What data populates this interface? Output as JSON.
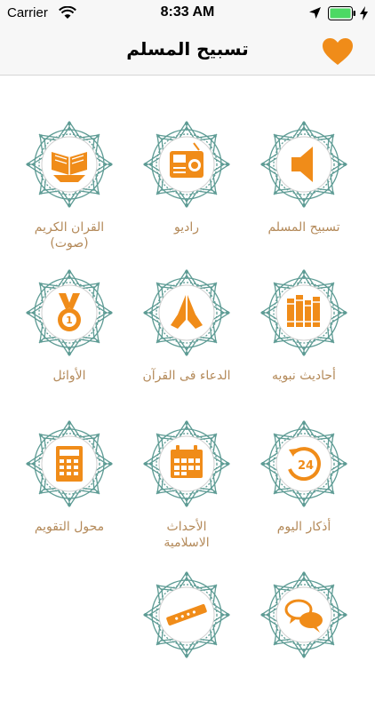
{
  "status_bar": {
    "carrier": "Carrier",
    "time": "8:33 AM"
  },
  "nav": {
    "title": "تسبيح المسلم"
  },
  "colors": {
    "accent": "#f08c19",
    "ornament": "#5d9b94",
    "label": "#b48a5a"
  },
  "grid": [
    {
      "label": "تسبيح المسلم",
      "icon": "speaker-icon"
    },
    {
      "label": "راديو",
      "icon": "radio-icon"
    },
    {
      "label": "القران الكريم\n(صوت)",
      "icon": "quran-book-icon"
    },
    {
      "label": "أحاديث نبويه",
      "icon": "books-icon"
    },
    {
      "label": "الدعاء فى القرآن",
      "icon": "praying-hands-icon"
    },
    {
      "label": "الأوائل",
      "icon": "medal-icon"
    },
    {
      "label": "أذكار اليوم",
      "icon": "24-hours-icon"
    },
    {
      "label": "الأحداث\nالاسلامية",
      "icon": "calendar-icon"
    },
    {
      "label": "محول التقويم",
      "icon": "calculator-icon"
    },
    {
      "label": "",
      "icon": "chat-bubbles-icon"
    },
    {
      "label": "",
      "icon": "flute-icon"
    }
  ]
}
